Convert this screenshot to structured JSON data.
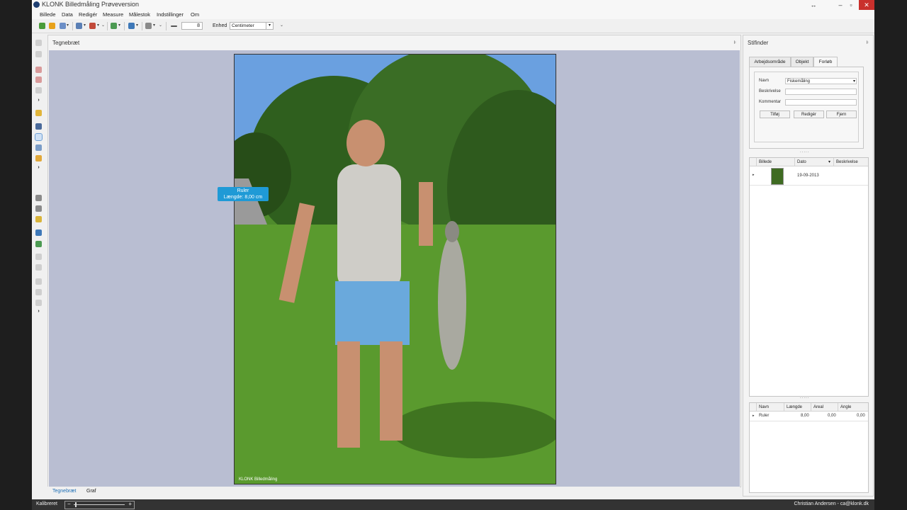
{
  "window": {
    "title": "KLONK Billedmåling Prøveversion"
  },
  "menu": [
    "Billede",
    "Data",
    "Redigér",
    "Measure",
    "Målestok",
    "Indstillinger",
    "Om"
  ],
  "toolbar": {
    "value": "8",
    "unit_label": "Enhed",
    "unit_value": "Centimeter"
  },
  "canvas_panel": {
    "title": "Tegnebræt",
    "watermark": "KLONK Billedmåling"
  },
  "measurement_label": {
    "line1": "Ruler",
    "line2": "Længde: 8,00 cm"
  },
  "bottom_tabs": [
    "Tegnebræt",
    "Graf"
  ],
  "right_panel": {
    "title": "Stifinder",
    "tabs": [
      "Arbejdsområde",
      "Objekt",
      "Forløb"
    ],
    "active_tab": "Forløb",
    "form": {
      "navn_label": "Navn",
      "navn_value": "Fiskemåling",
      "beskrivelse_label": "Beskrivelse",
      "kommentar_label": "Kommentar",
      "buttons": [
        "Tilføj",
        "Redigér",
        "Fjern"
      ]
    },
    "grid1": {
      "headers": [
        "Billede",
        "Dato",
        "Beskrivelse"
      ],
      "rows": [
        {
          "date": "19-09-2013",
          "description": ""
        }
      ]
    },
    "grid2": {
      "headers": [
        "Navn",
        "Længde",
        "Areal",
        "Angle"
      ],
      "rows": [
        {
          "navn": "Ruler",
          "laengde": "8,00",
          "areal": "0,00",
          "angle": "0,00"
        }
      ]
    },
    "splitter": "....."
  },
  "statusbar": {
    "left": "Kalibreret",
    "right": "Christian Andersen - ca@klonk.dk"
  }
}
